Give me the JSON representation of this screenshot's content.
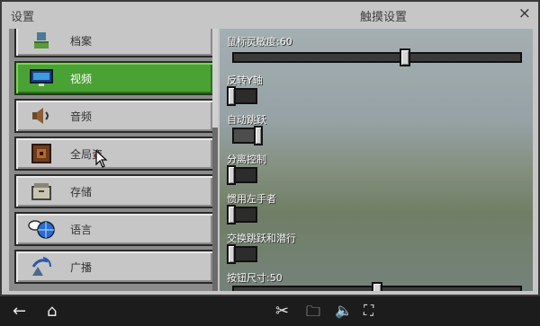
{
  "window": {
    "title_left": "设置",
    "title_right": "触摸设置",
    "close": "×"
  },
  "sidebar": {
    "items": [
      {
        "label": "档案",
        "icon": "profile-icon"
      },
      {
        "label": "视频",
        "icon": "monitor-icon",
        "active": true
      },
      {
        "label": "音频",
        "icon": "speaker-icon"
      },
      {
        "label": "全局资源",
        "icon": "global-resources-icon",
        "visible_label": "全局资"
      },
      {
        "label": "存储",
        "icon": "storage-icon"
      },
      {
        "label": "语言",
        "icon": "language-icon"
      },
      {
        "label": "广播",
        "icon": "broadcast-icon"
      }
    ],
    "accent": "#4aa234"
  },
  "touch": {
    "sensitivity": {
      "label": "鼠标灵敏度:60",
      "value": 60,
      "max": 100
    },
    "invert_y": {
      "label": "反转Y轴",
      "state": false
    },
    "auto_jump": {
      "label": "自动跳跃",
      "state": true
    },
    "split_controls": {
      "label": "分离控制",
      "state": false
    },
    "left_handed": {
      "label": "惯用左手者",
      "state": false
    },
    "swap_jump_sneak": {
      "label": "交换跳跃和潜行",
      "state": false
    },
    "button_size": {
      "label": "按钮尺寸:50",
      "value": 50,
      "max": 100
    }
  },
  "bottom_nav": {
    "back": "←",
    "home": "⌂",
    "scissors": "✂",
    "folder": "🗀",
    "volume": "🔈",
    "fullscreen": "⛶"
  }
}
